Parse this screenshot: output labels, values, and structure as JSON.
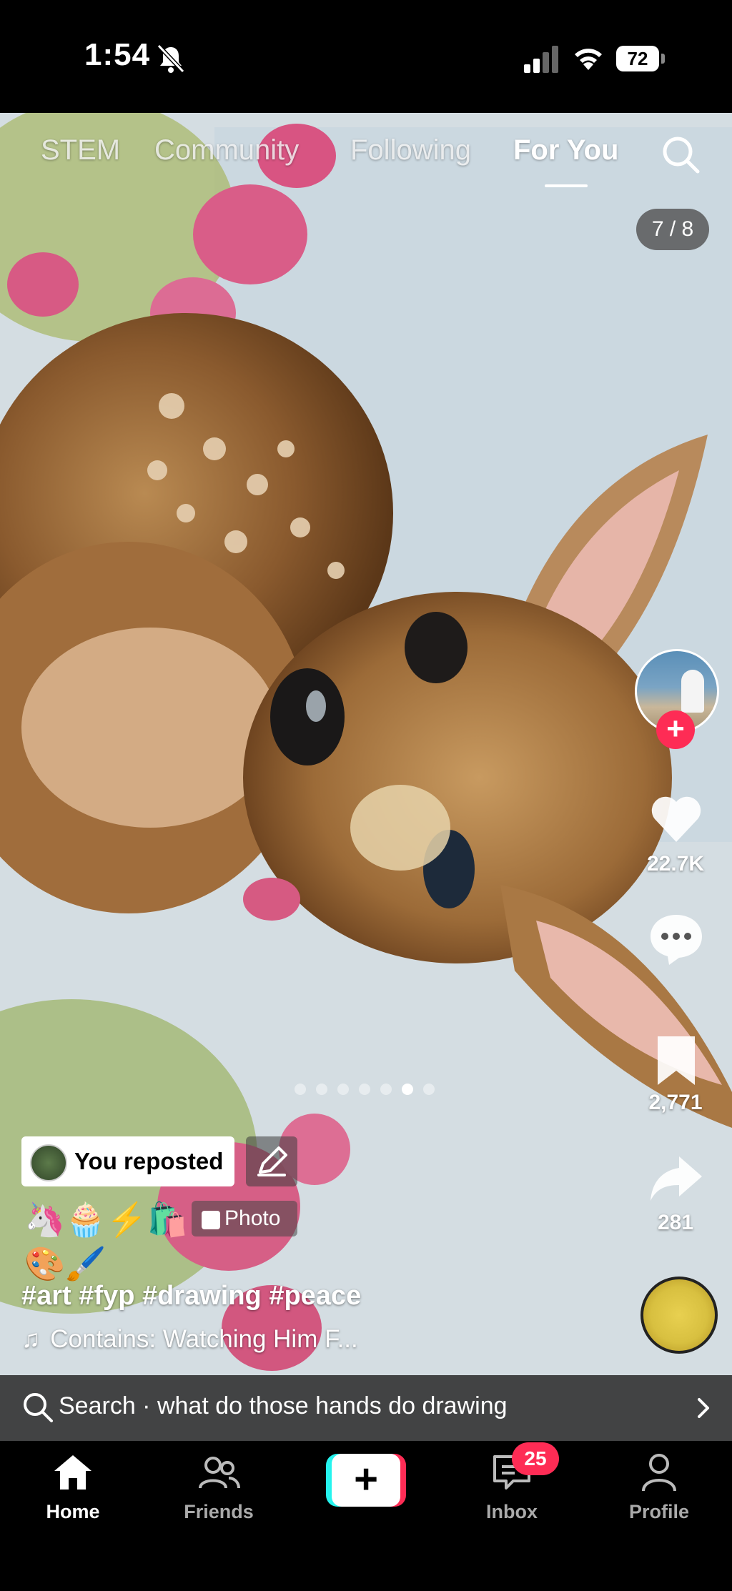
{
  "status_bar": {
    "time": "1:54",
    "battery": "72"
  },
  "top_tabs": [
    {
      "label": "STEM",
      "active": false
    },
    {
      "label": "Community",
      "active": false
    },
    {
      "label": "Following",
      "active": false
    },
    {
      "label": "For You",
      "active": true
    }
  ],
  "photo_counter": "7 / 8",
  "rail": {
    "likes": "22.7K",
    "bookmarks": "2,771",
    "shares": "281"
  },
  "carousel": {
    "pages": 7,
    "current_index": 5
  },
  "caption": {
    "reposted_label": "You reposted",
    "emojis_line1": "🦄🧁⚡🛍️",
    "emojis_line2": "🎨🖌️",
    "photo_badge": "Photo",
    "hashtags": "#art #fyp #drawing #peace",
    "sound": "Contains: Watching Him F..."
  },
  "search_suggestion": "Search · what do those hands do drawing",
  "bottom_nav": {
    "home": "Home",
    "friends": "Friends",
    "inbox": "Inbox",
    "inbox_badge": "25",
    "profile": "Profile"
  },
  "colors": {
    "accent": "#fe2c55",
    "cyan": "#25f4ee"
  }
}
